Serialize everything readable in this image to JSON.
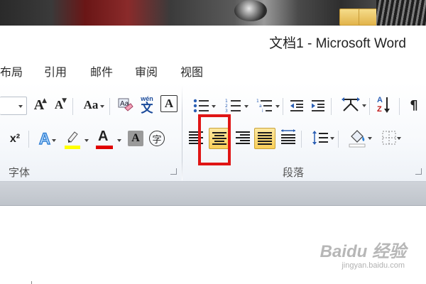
{
  "window": {
    "title": "文档1 - Microsoft Word"
  },
  "ribbon_tabs": [
    "布局",
    "引用",
    "邮件",
    "审阅",
    "视图"
  ],
  "font_group": {
    "label": "字体",
    "grow_font_icon": "A",
    "shrink_font_icon": "A",
    "change_case_icon": "Aa",
    "phonetic_guide_top": "wén",
    "phonetic_guide_char": "文",
    "char_border_icon": "A",
    "superscript_icon": "x²",
    "text_effects_icon": "A",
    "font_color_icon": "A",
    "char_shading_icon": "A",
    "enclose_char_icon": "字",
    "highlight_color": "#ffff00",
    "font_color": "#e00000"
  },
  "paragraph_group": {
    "label": "段落",
    "sort_icon_top": "A",
    "sort_icon_bottom": "Z",
    "selected_alignment": "center"
  },
  "highlight_annotation_color": "#e01515",
  "watermark": {
    "brand": "Baidu 经验",
    "url": "jingyan.baidu.com"
  }
}
